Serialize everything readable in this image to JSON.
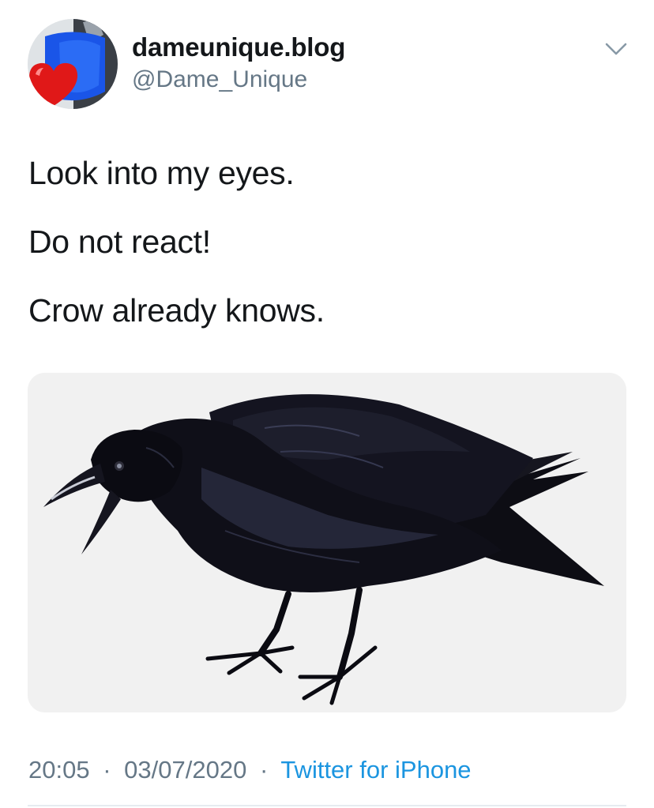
{
  "tweet": {
    "author": {
      "display_name": "dameunique.blog",
      "handle": "@Dame_Unique",
      "avatar_icon": "heart-avatar-icon"
    },
    "menu_icon": "chevron-down-icon",
    "text_lines": [
      "Look into my eyes.",
      "Do not react!",
      "Crow already knows."
    ],
    "media": {
      "icon": "crow-illustration",
      "background_color": "#f1f1f1"
    },
    "meta": {
      "time": "20:05",
      "separator": "·",
      "date": "03/07/2020",
      "source": "Twitter for iPhone"
    }
  },
  "colors": {
    "text_primary": "#14171a",
    "text_secondary": "#657786",
    "link": "#1b95e0",
    "divider": "#e6ecf0"
  }
}
